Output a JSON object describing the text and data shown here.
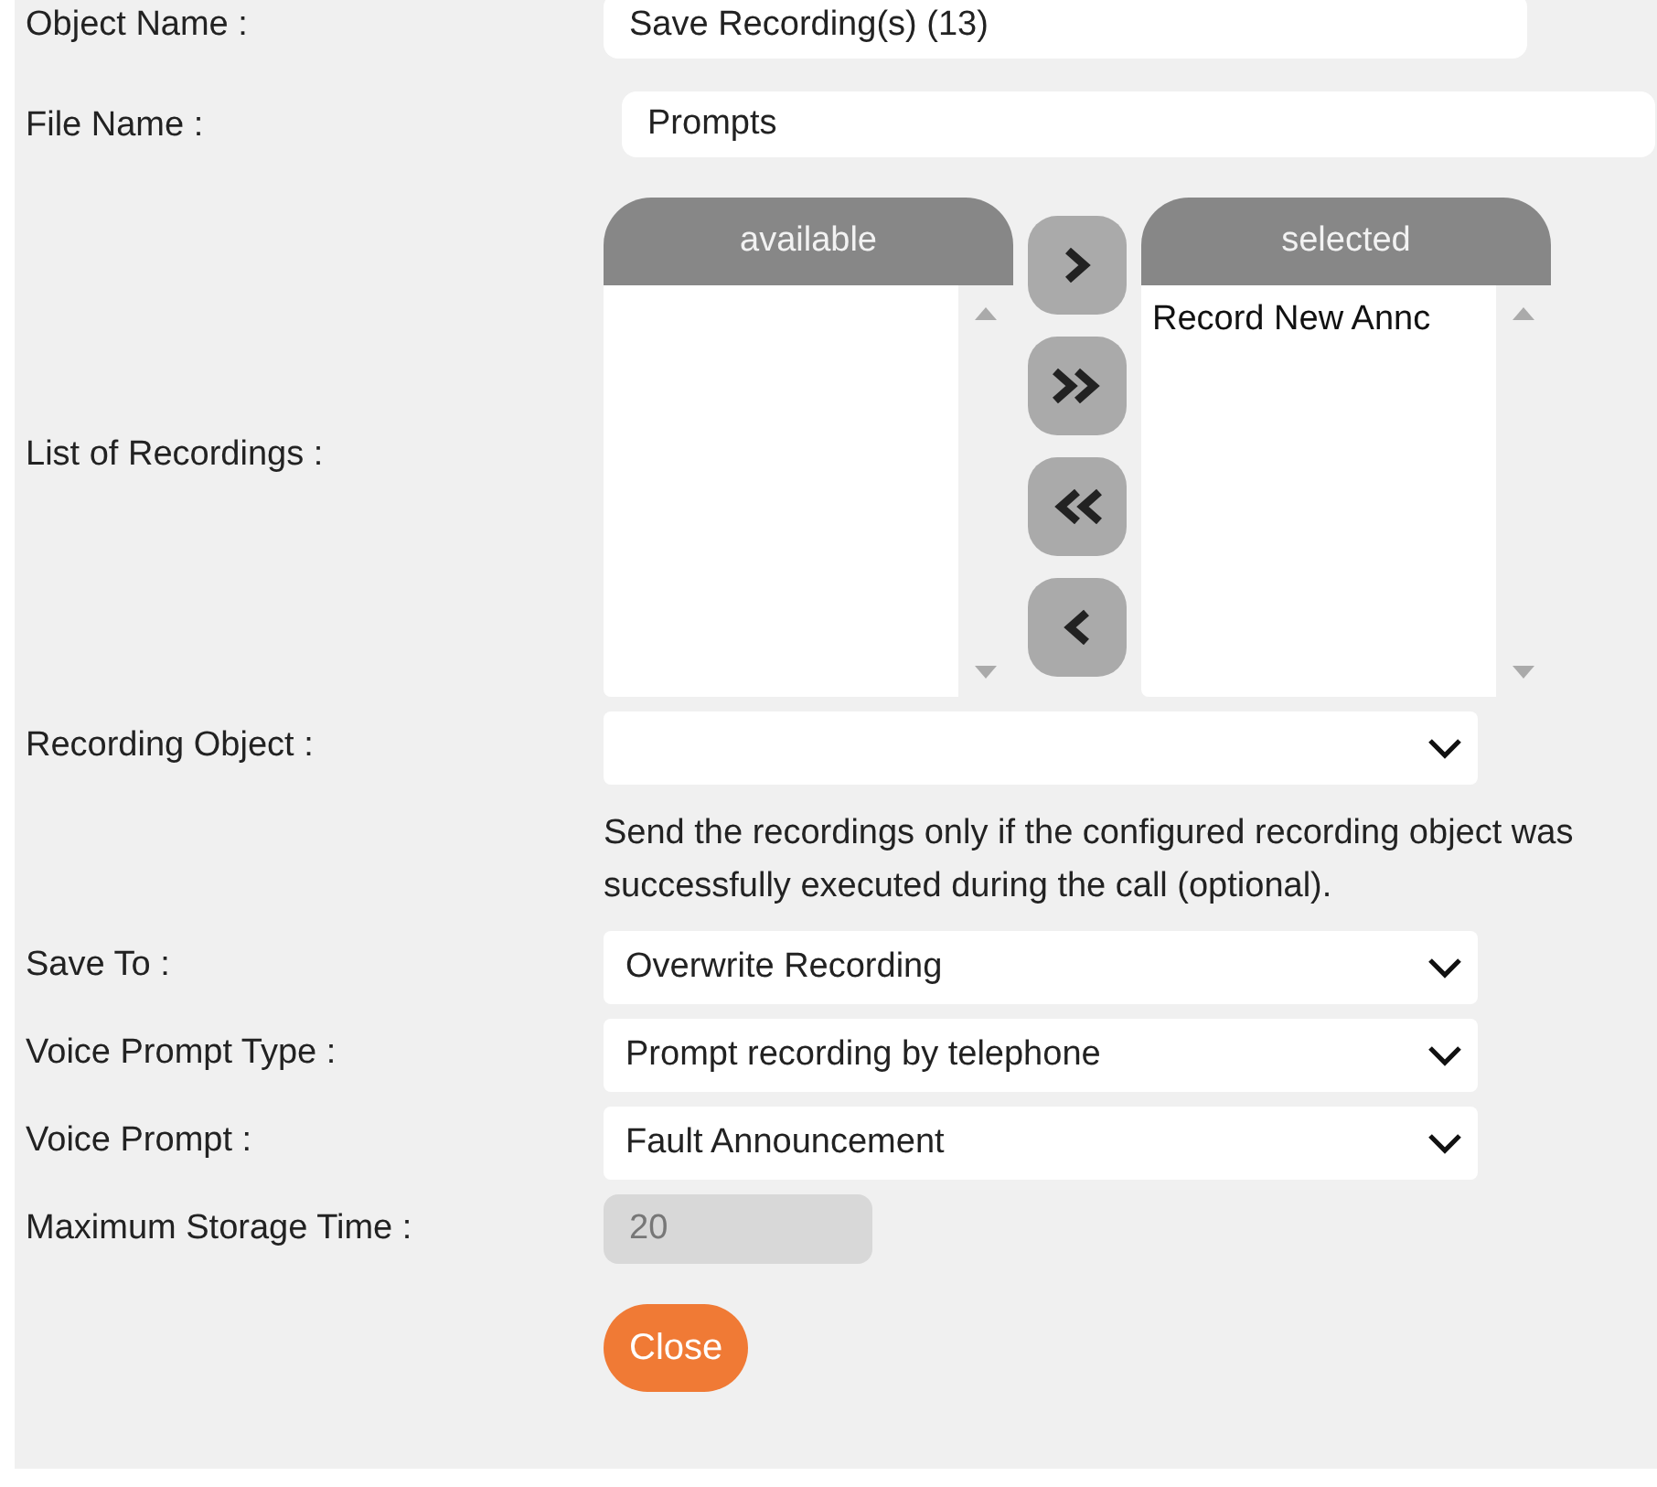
{
  "fields": [
    {
      "kind": "text",
      "label": "Object Name :",
      "value": "Save Recording(s) (13)"
    },
    {
      "kind": "text",
      "label": "File Name :",
      "value": "Prompts"
    },
    {
      "kind": "dual_list",
      "label": "List of Recordings :",
      "available": {
        "title": "available"
      },
      "selected": {
        "title": "selected",
        "items": [
          "Record New Annc"
        ]
      }
    },
    {
      "kind": "select",
      "label": "Recording Object :",
      "help": "Send the recordings only if the configured recording object was successfully executed during the call (optional)."
    },
    {
      "kind": "select",
      "label": "Save To :",
      "value": "Overwrite Recording"
    },
    {
      "kind": "select",
      "label": "Voice Prompt Type :",
      "value": "Prompt recording by telephone"
    },
    {
      "kind": "select",
      "label": "Voice Prompt :",
      "value": "Fault Announcement"
    },
    {
      "kind": "number",
      "label": "Maximum Storage Time :",
      "value": "20",
      "disabled": true
    }
  ],
  "buttons": [
    "Close"
  ]
}
